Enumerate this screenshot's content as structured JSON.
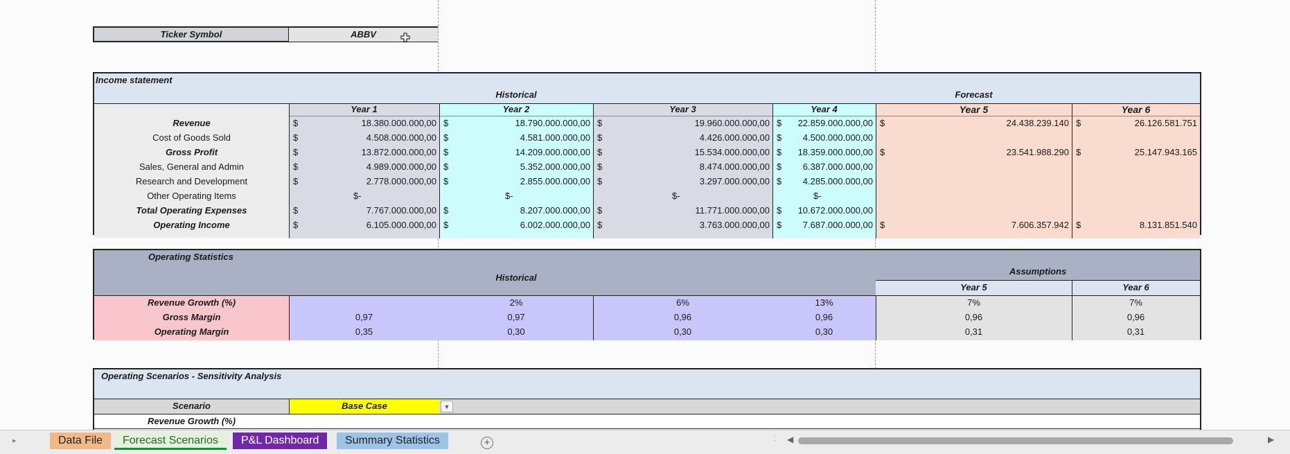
{
  "ticker": {
    "label": "Ticker Symbol",
    "value": "ABBV"
  },
  "income_statement": {
    "title": "Income statement",
    "historical_label": "Historical",
    "forecast_label": "Forecast",
    "years": [
      "Year 1",
      "Year 2",
      "Year 3",
      "Year 4",
      "Year 5",
      "Year 6"
    ],
    "rows": [
      {
        "label": "Revenue",
        "bold": true,
        "values": [
          "18.380.000.000,00",
          "18.790.000.000,00",
          "19.960.000.000,00",
          "22.859.000.000,00",
          "24.438.239.140",
          "26.126.581.751"
        ]
      },
      {
        "label": "Cost of Goods Sold",
        "bold": false,
        "values": [
          "4.508.000.000,00",
          "4.581.000.000,00",
          "4.426.000.000,00",
          "4.500.000.000,00",
          "",
          ""
        ]
      },
      {
        "label": "Gross Profit",
        "bold": true,
        "values": [
          "13.872.000.000,00",
          "14.209.000.000,00",
          "15.534.000.000,00",
          "18.359.000.000,00",
          "23.541.988.290",
          "25.147.943.165"
        ]
      },
      {
        "label": "Sales, General and Admin",
        "bold": false,
        "values": [
          "4.989.000.000,00",
          "5.352.000.000,00",
          "8.474.000.000,00",
          "6.387.000.000,00",
          "",
          ""
        ]
      },
      {
        "label": "Research and Development",
        "bold": false,
        "values": [
          "2.778.000.000,00",
          "2.855.000.000,00",
          "3.297.000.000,00",
          "4.285.000.000,00",
          "",
          ""
        ]
      },
      {
        "label": "Other Operating Items",
        "bold": false,
        "values": [
          "$-",
          "$-",
          "$-",
          "$-",
          "",
          ""
        ]
      },
      {
        "label": "Total Operating Expenses",
        "bold": true,
        "values": [
          "7.767.000.000,00",
          "8.207.000.000,00",
          "11.771.000.000,00",
          "10.672.000.000,00",
          "",
          ""
        ]
      },
      {
        "label": "Operating Income",
        "bold": true,
        "values": [
          "6.105.000.000,00",
          "6.002.000.000,00",
          "3.763.000.000,00",
          "7.687.000.000,00",
          "7.606.357.942",
          "8.131.851.540"
        ]
      }
    ],
    "currency_symbol": "$"
  },
  "operating_statistics": {
    "title": "Operating Statistics",
    "historical_label": "Historical",
    "assumptions_label": "Assumptions",
    "year5": "Year 5",
    "year6": "Year 6",
    "rows": [
      {
        "label": "Revenue Growth (%)",
        "values": [
          "",
          "2%",
          "6%",
          "13%",
          "7%",
          "7%"
        ]
      },
      {
        "label": "Gross Margin",
        "values": [
          "0,97",
          "0,97",
          "0,96",
          "0,96",
          "0,96",
          "0,96"
        ]
      },
      {
        "label": "Operating Margin",
        "values": [
          "0,35",
          "0,30",
          "0,30",
          "0,30",
          "0,31",
          "0,31"
        ]
      }
    ]
  },
  "scenarios": {
    "title": "Operating Scenarios - Sensitivity Analysis",
    "scenario_label": "Scenario",
    "scenario_value": "Base Case",
    "revenue_growth_label": "Revenue Growth (%)"
  },
  "tabs": [
    "Data File",
    "Forecast Scenarios",
    "P&L Dashboard",
    "Summary Statistics"
  ],
  "colors": {
    "hist_gray": "#d8dbe3",
    "hist_cyan": "#ccfcfb",
    "forecast_peach": "#f9dccf",
    "header_blue": "#dbe5f1",
    "stats_header": "#aab1c4",
    "stats_purple": "#c8c6fa",
    "stats_pink": "#f8c6cc",
    "assume_gray": "#e3e3e3",
    "scenario_yellow": "#ffff00"
  }
}
